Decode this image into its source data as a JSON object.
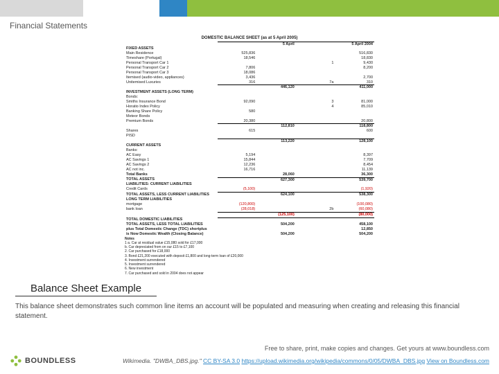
{
  "header": {
    "section": "Financial Statements"
  },
  "figure": {
    "title": "DOMESTIC BALANCE SHEET (as at 5 April 2005)",
    "col1": "5 April",
    "col2": "5 April 2004",
    "groups": [
      {
        "name": "FIXED ASSETS",
        "rows": [
          {
            "label": "Main Residence",
            "a": "525,836",
            "n": "",
            "b": "516,830"
          },
          {
            "label": "Timeshare (Portugal)",
            "a": "18,546",
            "n": "",
            "b": "18,830"
          },
          {
            "label": "Personal Transport Car 1",
            "a": "",
            "n": "1",
            "b": "9,430"
          },
          {
            "label": "Personal Transport Car 2",
            "a": "7,806",
            "n": "",
            "b": "8,200"
          },
          {
            "label": "Personal Transport Car 3",
            "a": "18,086",
            "n": "",
            "b": ""
          },
          {
            "label": "Itemised (audio-video, appliances)",
            "a": "3,436",
            "n": "",
            "b": "2,700"
          },
          {
            "label": "Unitemised Luxuries",
            "a": "316",
            "n": "7a",
            "b": "310"
          }
        ],
        "subtotal": {
          "a": "446,120",
          "b": "411,000"
        }
      },
      {
        "name": "INVESTMENT ASSETS (LONG TERM)",
        "rows": [
          {
            "label": "Bonds:",
            "a": "",
            "n": "",
            "b": ""
          },
          {
            "label": "Smiths Insurance Bond",
            "a": "92,090",
            "n": "3",
            "b": "81,000"
          },
          {
            "label": "Horatio Index Policy",
            "a": "",
            "n": "4",
            "b": "85,010"
          },
          {
            "label": "Banking Share Policy",
            "a": "580",
            "n": "",
            "b": ""
          },
          {
            "label": "Meteor Bonds",
            "a": "",
            "n": "",
            "b": ""
          },
          {
            "label": "Premium Bonds",
            "a": "20,380",
            "n": "",
            "b": "20,800"
          }
        ],
        "subtotal_inline": {
          "a": "112,810",
          "b": "118,800"
        },
        "sub2": [
          {
            "label": "Shares",
            "a": "615",
            "n": "",
            "b": "600"
          },
          {
            "label": "PISD",
            "a": "",
            "n": "",
            "b": ""
          }
        ],
        "subtotal": {
          "a": "113,220",
          "b": "128,100"
        }
      },
      {
        "name": "CURRENT ASSETS",
        "rows": [
          {
            "label": "Banks:",
            "a": "",
            "n": "",
            "b": ""
          },
          {
            "label": "AC Easy",
            "a": "5,194",
            "n": "",
            "b": "8,397"
          },
          {
            "label": "AC Savings 1",
            "a": "15,844",
            "n": "",
            "b": "7,709"
          },
          {
            "label": "AC Savings 2",
            "a": "12,236",
            "n": "",
            "b": "8,454"
          },
          {
            "label": "AC not inc.",
            "a": "16,716",
            "n": "",
            "b": "11,139"
          },
          {
            "label": "Total Banks",
            "a": "",
            "n": "",
            "b": "36,300",
            "bold": true,
            "a2": "28,060"
          }
        ],
        "total": {
          "label": "TOTAL ASSETS",
          "a": "627,300",
          "b": "539,700"
        }
      },
      {
        "name": "LIABILITIES:\nCURRENT LIABILITIES",
        "rows": [
          {
            "label": "Credit Cards",
            "a": "(5,100)",
            "n": "",
            "b": "(1,920)",
            "red": true
          }
        ],
        "total": {
          "label": "TOTAL ASSETS, LESS CURRENT LIABILITIES",
          "a": "624,100",
          "b": "538,300"
        }
      },
      {
        "name": "LONG TERM LIABILITIES",
        "rows": [
          {
            "label": "mortgage",
            "a": "(120,800)",
            "n": "",
            "b": "(100,080)",
            "red": true
          },
          {
            "label": "bank loan",
            "a": "(28,018)",
            "n": "2b",
            "b": "(60,080)",
            "red": true
          }
        ],
        "subtotal": {
          "a": "(125,100)",
          "b": "(80,000)",
          "red": true
        },
        "total": {
          "label": "TOTAL DOMESTIC LIABILITIES",
          "a": "",
          "b": ""
        }
      }
    ],
    "final": [
      {
        "label": "TOTAL ASSETS, LESS TOTAL LIABILITIES",
        "a": "504,200",
        "b": "458,100"
      },
      {
        "label": "plus Total Domestic Change (TDC) shortplus",
        "a": "",
        "b": "12,850"
      },
      {
        "label": "is Now Domestic Wealth (Closing Balance)",
        "a": "504,200",
        "b": "504,200"
      }
    ],
    "notes_title": "Notes",
    "notes": [
      "1 a. Car at residual value £15,080 sold for £17,000",
      "  b. Car depreciated from on our £15 to £7,100",
      "2. Car purchased for £18,000",
      "3. Bond £21,200 executed with deposit £1,800 and long-term loan of £20,000",
      "4. Investment surrendered",
      "5. Investment surrendered",
      "6. New investment",
      "7. Car purchased and sold in 2004 does not appear"
    ]
  },
  "caption": {
    "title": "Balance Sheet Example",
    "body": "This balance sheet demonstrates such common line items an account will be populated and measuring when creating and releasing this financial statement."
  },
  "footer": {
    "share": "Free to share, print, make copies and changes. Get yours at www.boundless.com",
    "attr_prefix": "Wikimedia.",
    "attr_quote": "\"DWBA_DBS.jpg.\"",
    "license": "CC BY-SA 3.0",
    "src": "https://upload.wikimedia.org/wikipedia/commons/0/05/DWBA_DBS.jpg",
    "view": "View on Boundless.com",
    "brand": "BOUNDLESS"
  }
}
